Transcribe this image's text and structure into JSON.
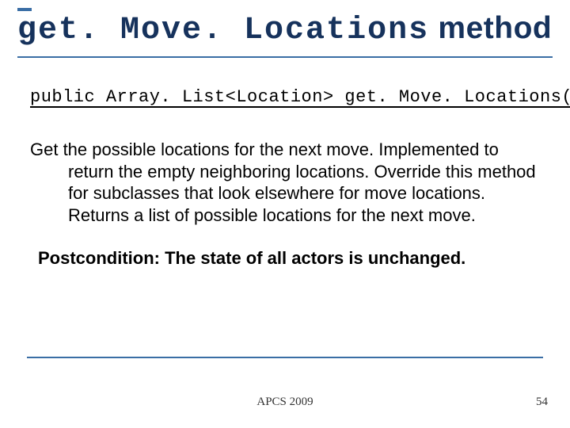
{
  "title": {
    "code": "get. Move. Locations",
    "rest": " method"
  },
  "signature": "public Array. List<Location> get. Move. Locations()",
  "description": "Get the possible locations for the next move. Implemented to return the empty neighboring locations. Override this method for subclasses that look elsewhere for move locations. Returns a list of possible locations for the next move.",
  "postcondition": "Postcondition: The state of all actors is unchanged.",
  "footer": {
    "center": "APCS 2009",
    "page": "54"
  }
}
